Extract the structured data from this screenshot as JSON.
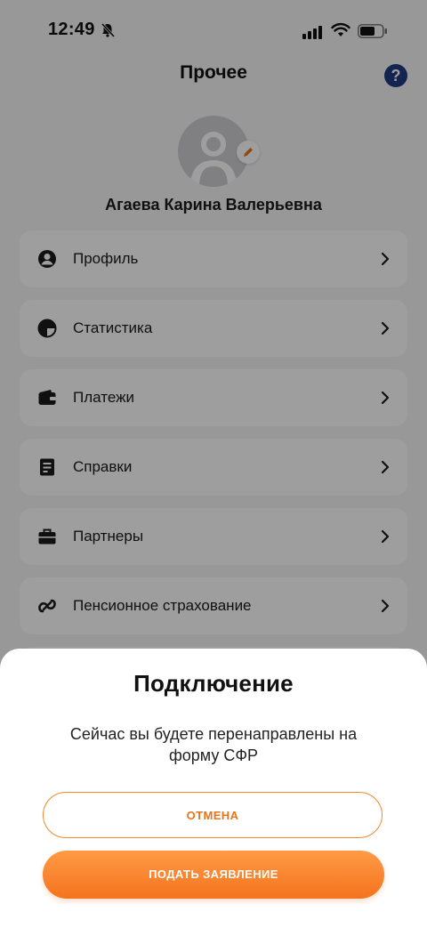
{
  "status_bar": {
    "time": "12:49"
  },
  "header": {
    "title": "Прочее",
    "help": "?"
  },
  "user": {
    "name": "Агаева Карина Валерьевна"
  },
  "menu": {
    "items": [
      {
        "label": "Профиль",
        "icon": "profile-icon"
      },
      {
        "label": "Статистика",
        "icon": "statistics-icon"
      },
      {
        "label": "Платежи",
        "icon": "wallet-icon"
      },
      {
        "label": "Справки",
        "icon": "document-icon"
      },
      {
        "label": "Партнеры",
        "icon": "briefcase-icon"
      },
      {
        "label": "Пенсионное страхование",
        "icon": "pension-icon"
      }
    ]
  },
  "dialog": {
    "title": "Подключение",
    "message": "Сейчас вы будете перенаправлены на форму СФР",
    "cancel_label": "ОТМЕНА",
    "submit_label": "ПОДАТЬ ЗАЯВЛЕНИЕ"
  },
  "colors": {
    "accent": "#f5731e",
    "help": "#1f3a82"
  }
}
